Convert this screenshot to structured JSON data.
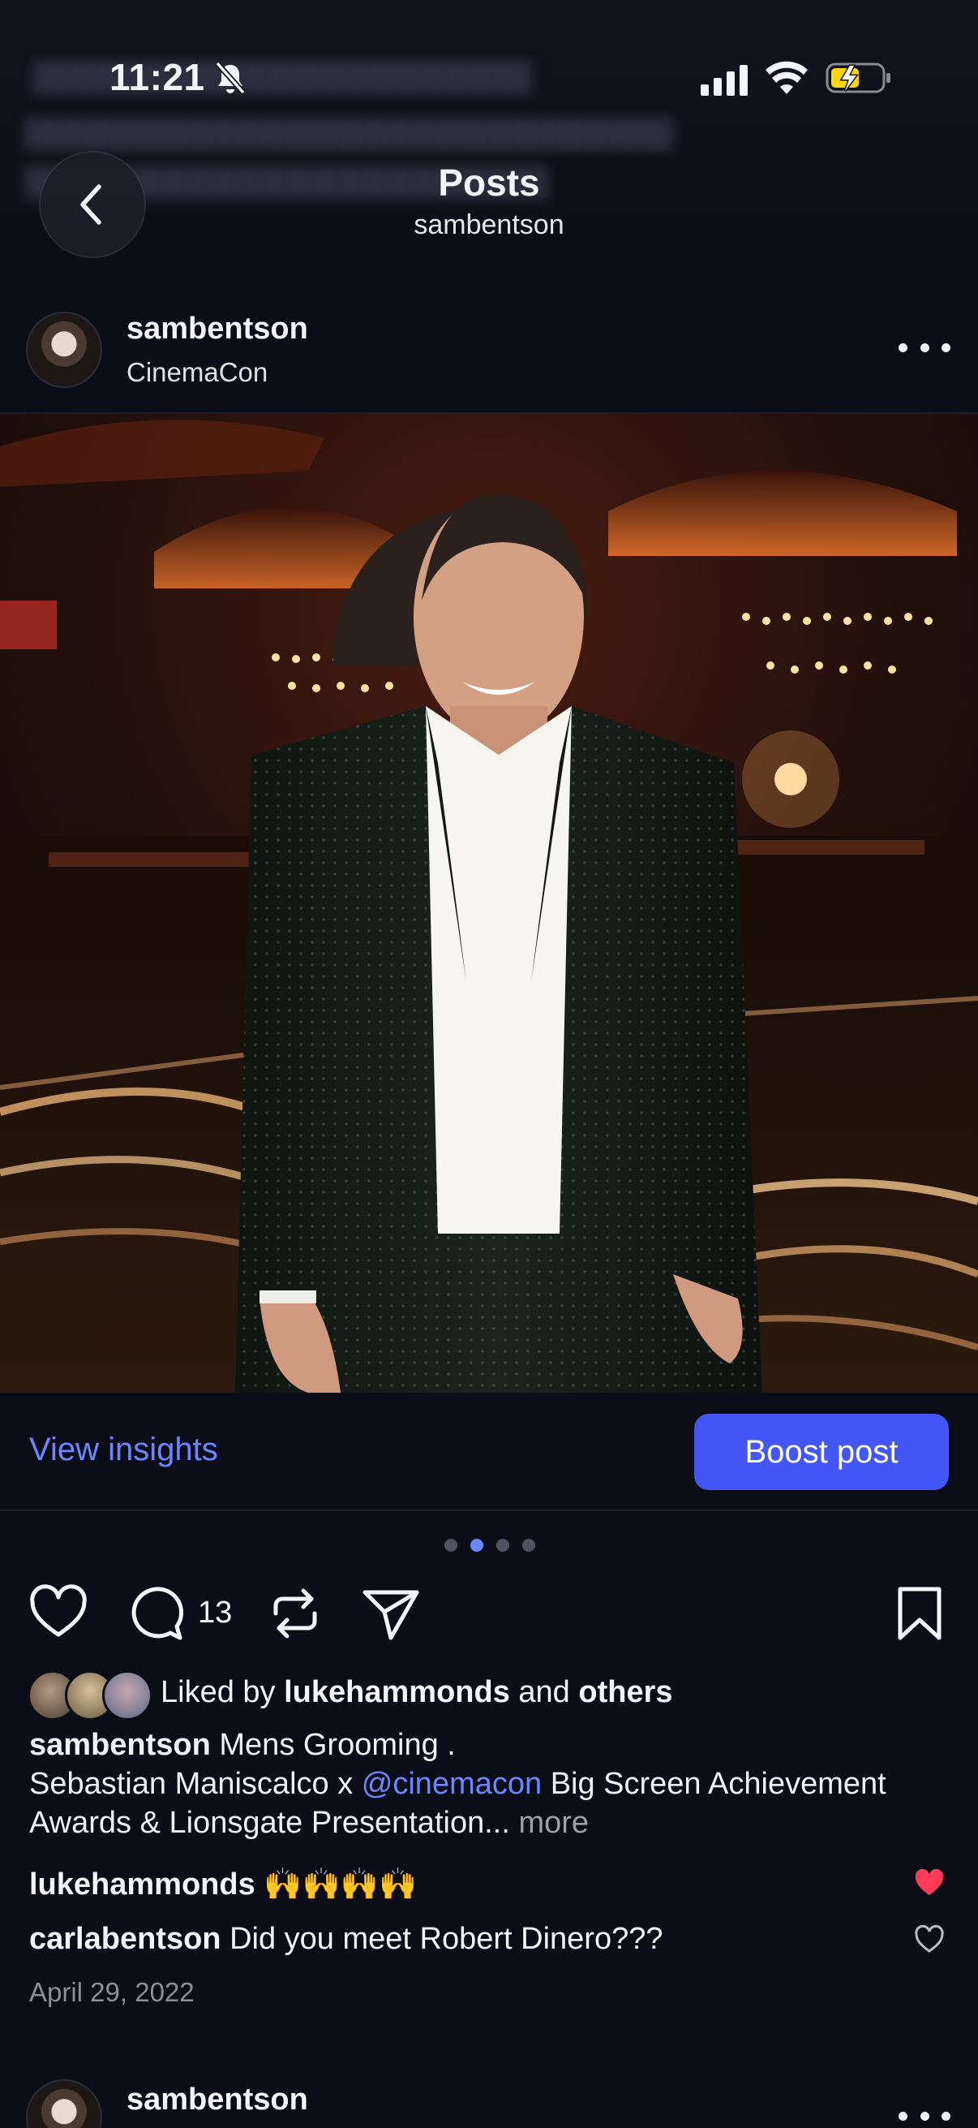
{
  "status_bar": {
    "time": "11:21",
    "icons": [
      "bell-slash-icon",
      "cellular-signal-icon",
      "wifi-icon",
      "battery-charging-icon"
    ]
  },
  "header": {
    "title": "Posts",
    "subtitle": "sambentson",
    "back_icon": "chevron-left-icon"
  },
  "post": {
    "username": "sambentson",
    "location": "CinemaCon",
    "more_icon": "ellipsis-icon",
    "photo_description": "photo",
    "insights_label": "View insights",
    "boost_label": "Boost post",
    "carousel": {
      "count": 4,
      "active_index": 1
    },
    "actions": {
      "like_icon": "heart-outline-icon",
      "comment_icon": "comment-icon",
      "comment_count": "13",
      "repost_icon": "repost-icon",
      "share_icon": "send-icon",
      "save_icon": "bookmark-icon"
    },
    "likes": {
      "prefix": "Liked by",
      "user": "lukehammonds",
      "connector": "and",
      "others": "others"
    },
    "caption": {
      "username": "sambentson",
      "first_line": "Mens Grooming .",
      "body_before_mention": "Sebastian Maniscalco x",
      "mention": "@cinemacon",
      "body_after_mention": "Big Screen Achievement Awards & Lionsgate Presentation...",
      "more_label": "more"
    },
    "comments": [
      {
        "username": "lukehammonds",
        "text": "🙌🙌🙌🙌",
        "liked": true
      },
      {
        "username": "carlabentson",
        "text": "Did you meet Robert Dinero???",
        "liked": false
      }
    ],
    "date": "April 29, 2022"
  },
  "next_post": {
    "username": "sambentson"
  },
  "colors": {
    "background": "#0c0e17",
    "accent": "#6b86ff",
    "boost_button": "#4257f5",
    "like_red": "#ff3b57"
  }
}
